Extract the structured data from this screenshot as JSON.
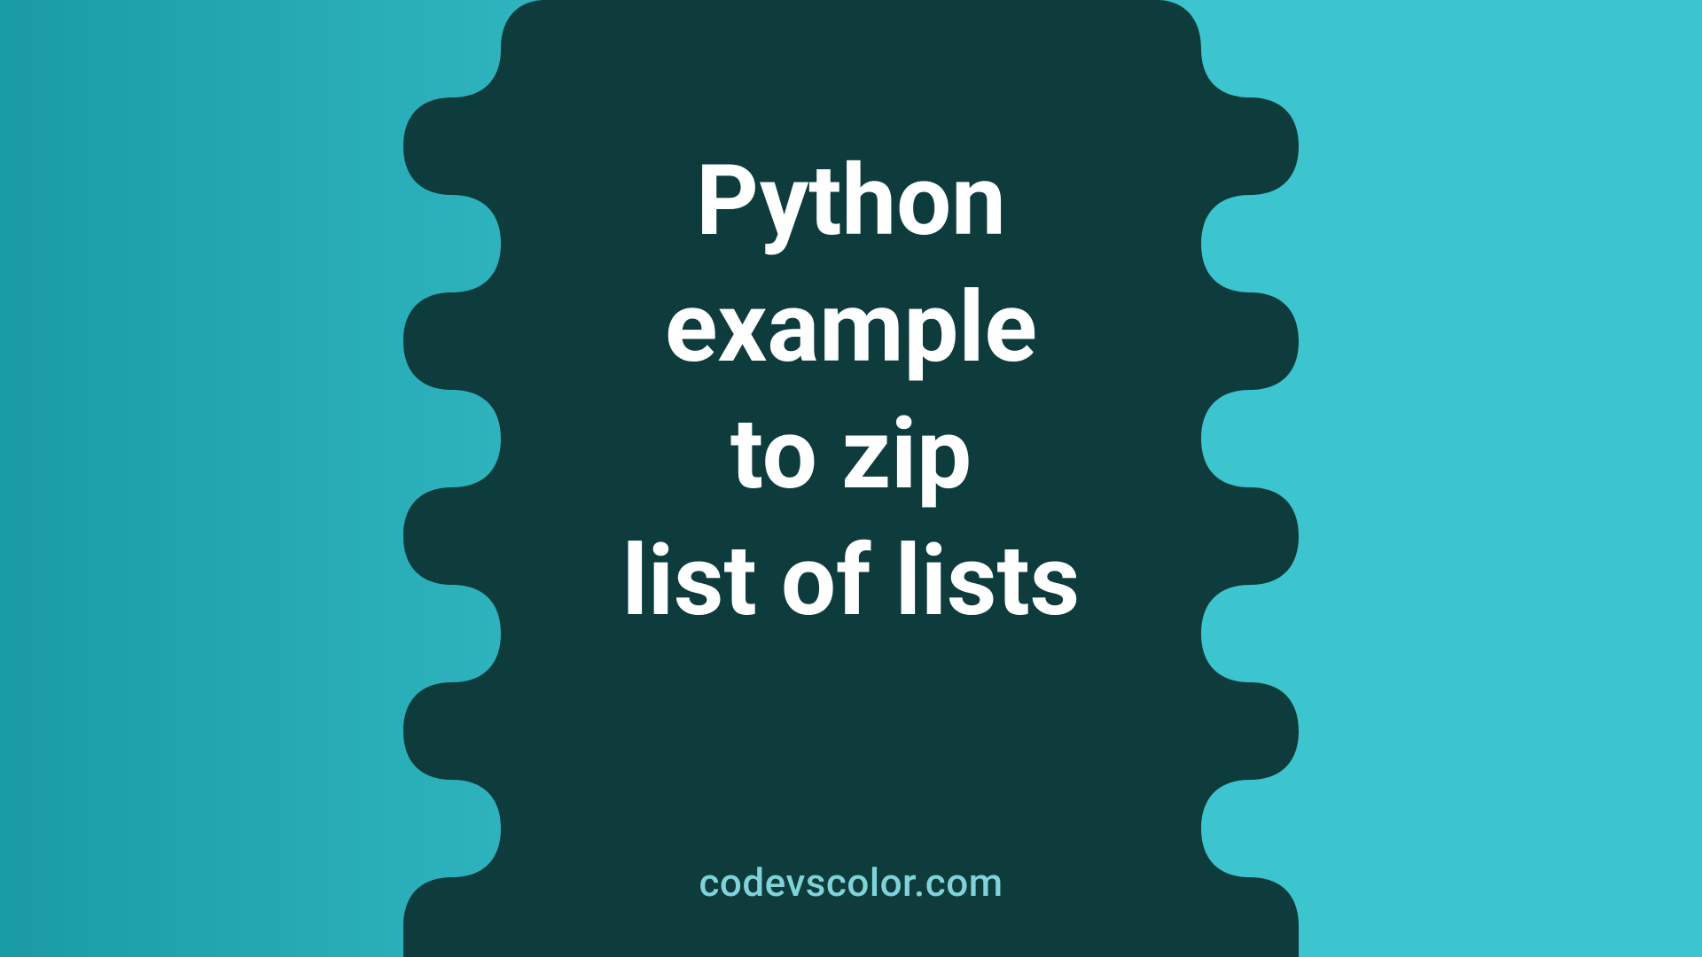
{
  "title_lines": [
    "Python",
    "example",
    "to zip",
    "list of lists"
  ],
  "site": "codevscolor.com",
  "colors": {
    "bg_gradient_from": "#1a9ba5",
    "bg_gradient_to": "#3cc4cf",
    "blob": "#0e3b3b",
    "title_text": "#ffffff",
    "site_text": "#7fd3d9"
  }
}
